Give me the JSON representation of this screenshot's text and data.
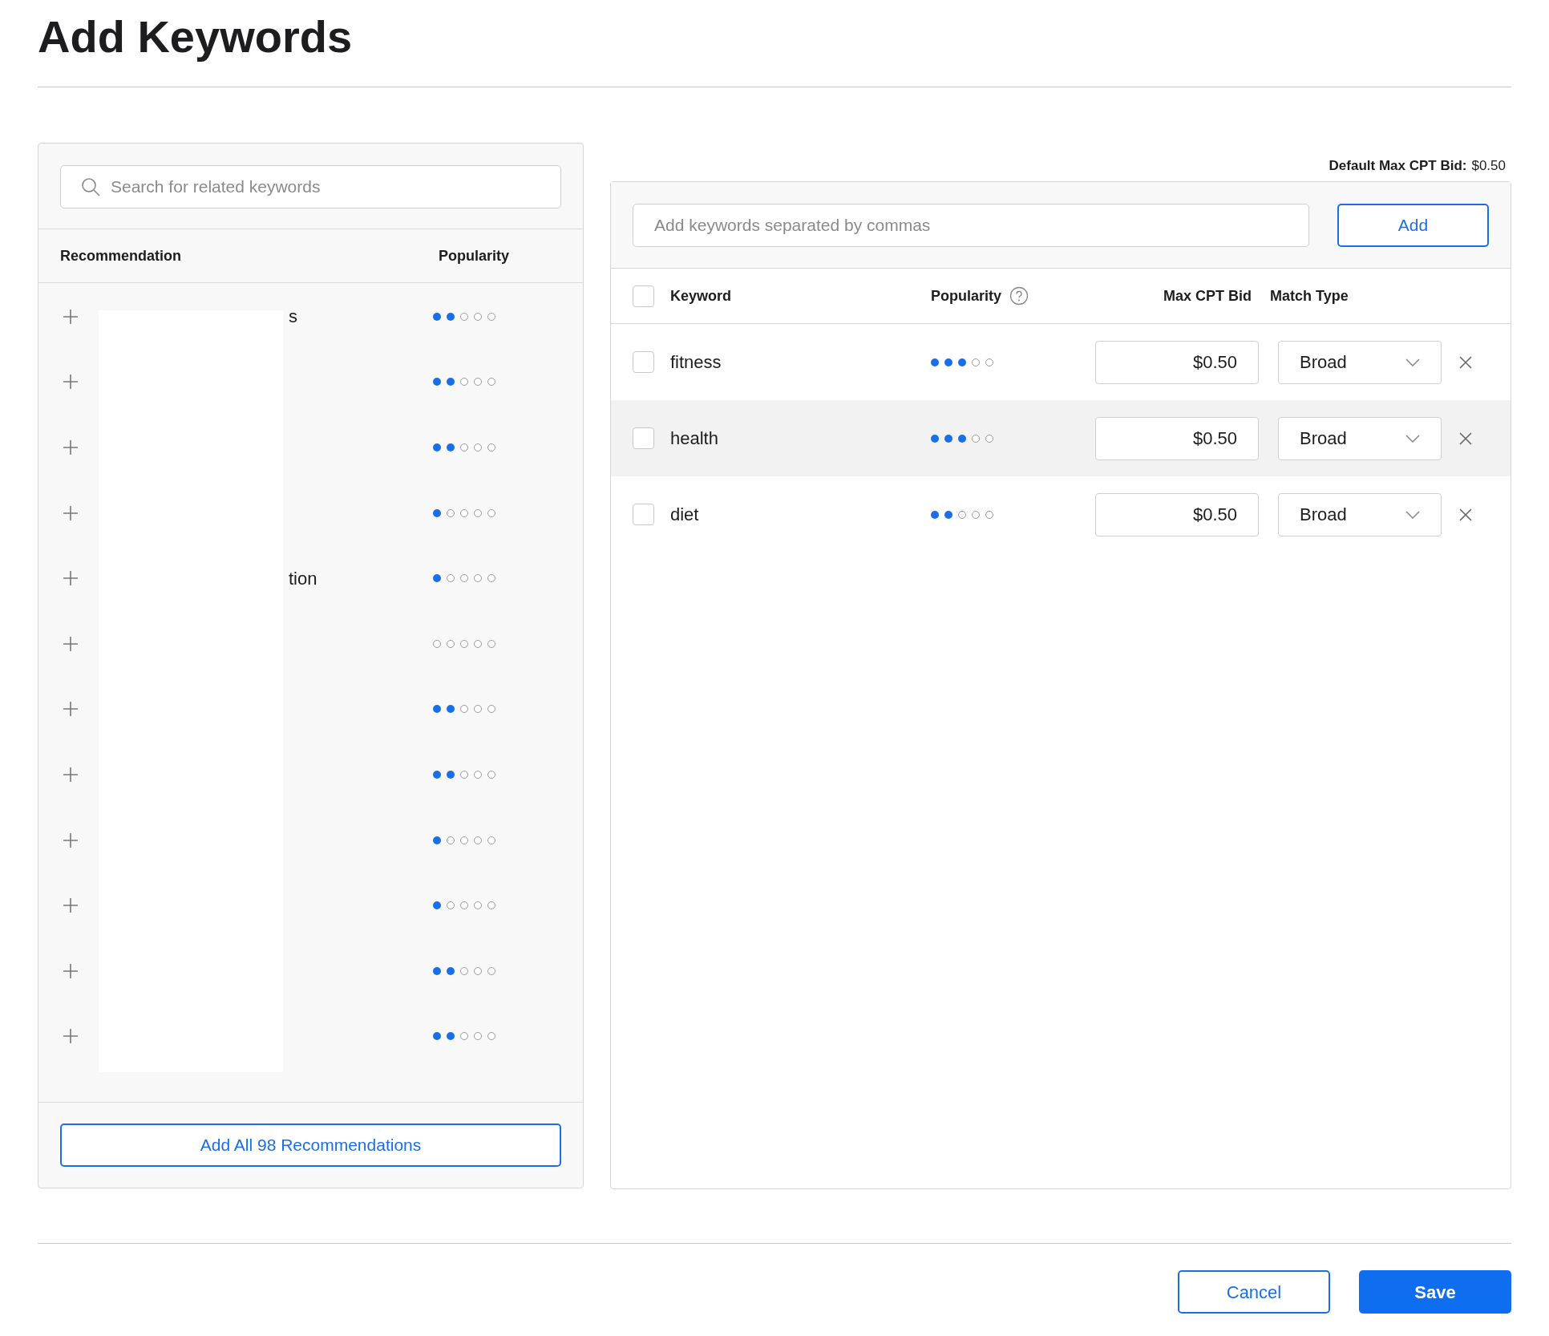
{
  "title": "Add Keywords",
  "recommendations": {
    "search": {
      "placeholder": "Search for related keywords"
    },
    "columns": [
      "Recommendation",
      "Popularity"
    ],
    "rows": [
      {
        "keyword": "s",
        "stars": 2
      },
      {
        "stars": 2
      },
      {
        "stars": 2
      },
      {
        "stars": 1
      },
      {
        "keyword": "tion",
        "stars": 1
      },
      {
        "stars": 0
      },
      {
        "stars": 2
      },
      {
        "stars": 2
      },
      {
        "stars": 1
      },
      {
        "stars": 1
      },
      {
        "stars": 2
      },
      {
        "stars": 2
      }
    ],
    "add_all_button": "Add All 98 Recommendations"
  },
  "default_bid": {
    "label": "Default Max CPT Bid:",
    "value": "$0.50"
  },
  "keywords": {
    "input": {
      "placeholder": "Add keywords separated by commas"
    },
    "add_button": "Add",
    "columns": [
      "Keyword",
      "Popularity",
      "Max CPT Bid",
      "Match Type"
    ],
    "header_checked": false,
    "rows": [
      {
        "keyword": "fitness",
        "checked": false,
        "stars": 3,
        "bid": "$0.50",
        "match_type": "Broad",
        "selected": false
      },
      {
        "keyword": "health",
        "checked": false,
        "stars": 3,
        "bid": "$0.50",
        "match_type": "Broad",
        "selected": true
      },
      {
        "keyword": "diet",
        "checked": false,
        "stars": 2,
        "bid": "$0.50",
        "match_type": "Broad",
        "selected": false
      }
    ]
  },
  "footer": {
    "cancel": "Cancel",
    "save": "Save"
  }
}
